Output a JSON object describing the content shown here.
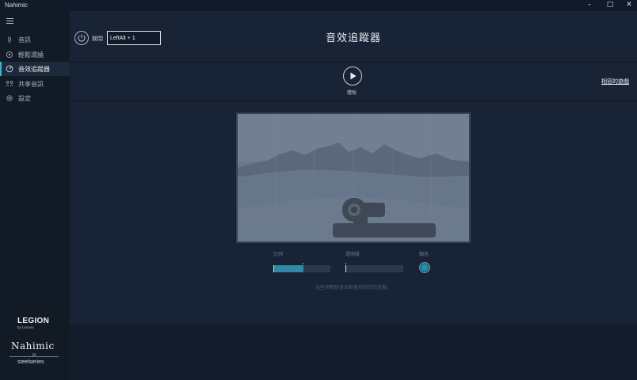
{
  "window": {
    "app_title": "Nahimic",
    "controls": {
      "minimize": "–",
      "maximize": "□",
      "close": "✕"
    }
  },
  "sidebar": {
    "menu_icon": "hamburger-icon",
    "items": [
      {
        "label": "音訊",
        "icon": "audio-icon",
        "active": false
      },
      {
        "label": "輕鬆環繞",
        "icon": "surround-icon",
        "active": false
      },
      {
        "label": "音效追蹤器",
        "icon": "tracker-icon",
        "active": true
      },
      {
        "label": "共享音訊",
        "icon": "share-icon",
        "active": false
      },
      {
        "label": "設定",
        "icon": "gear-icon",
        "active": false
      }
    ],
    "brand": {
      "legion": "LEGION",
      "legion_sub": "by Lenovo",
      "nahimic": "Nahimic",
      "by": "BY",
      "steelseries": "steelseries"
    }
  },
  "header": {
    "title": "音效追蹤器",
    "power_label": "關閉",
    "hotkey_value": "LeftAlt + 1"
  },
  "toolbar": {
    "play_label": "體驗",
    "compatible_games_link": "相容的遊戲"
  },
  "controls": {
    "size_label": "比例",
    "size_value": 0.53,
    "opacity_label": "透明度",
    "opacity_value": 0.02,
    "color_label": "顏色",
    "accent_color": "#2191b3",
    "hint": "這些參數將會自動套用到您的遊戲。"
  }
}
